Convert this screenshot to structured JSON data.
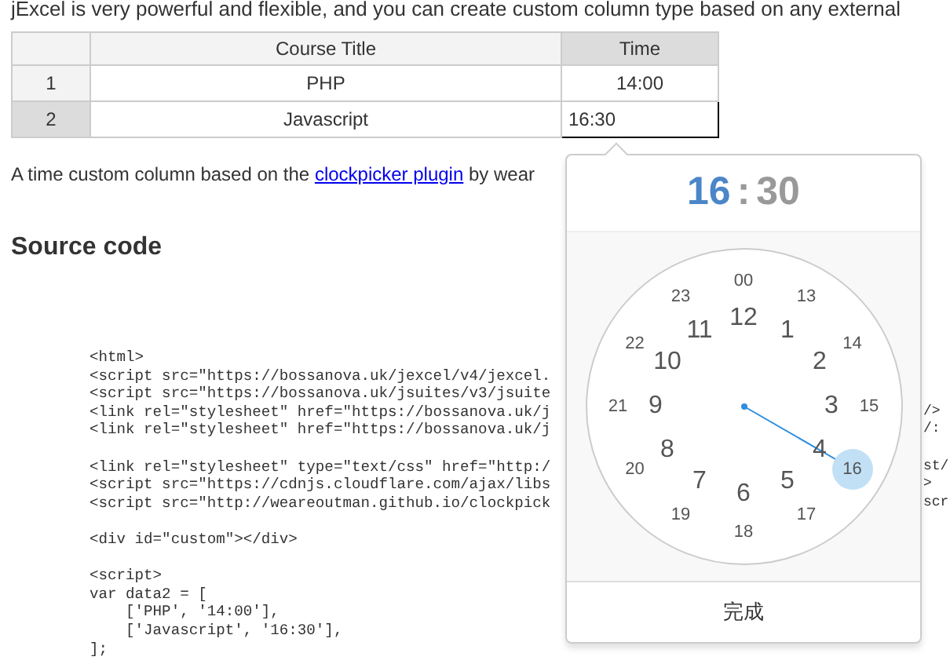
{
  "intro": "jExcel is very powerful and flexible, and you can create custom column type based on any external",
  "table": {
    "columns": [
      "Course Title",
      "Time"
    ],
    "rows": [
      {
        "number": "1",
        "cells": [
          "PHP",
          "14:00"
        ],
        "selected": false
      },
      {
        "number": "2",
        "cells": [
          "Javascript",
          "16:30"
        ],
        "selected": true
      }
    ]
  },
  "description": {
    "before": "A time custom column based on the ",
    "link": "clockpicker plugin",
    "after": " by wear"
  },
  "heading": "Source code",
  "code": [
    [
      {
        "text": "<html>"
      },
      {
        "text": "<script src=\"https://bossanova.uk/jexcel/v4/jexcel."
      },
      {
        "text": "<script src=\"https://bossanova.uk/jsuites/v3/jsuite"
      },
      {
        "text": "<link rel=\"stylesheet\" href=\"https://bossanova.uk/j",
        "tail": "/>"
      },
      {
        "text": "<link rel=\"stylesheet\" href=\"https://bossanova.uk/j",
        "tail": "/:"
      }
    ],
    [
      {
        "text": "<link rel=\"stylesheet\" type=\"text/css\" href=\"http:/",
        "tail": "st/"
      },
      {
        "text": "<script src=\"https://cdnjs.cloudflare.com/ajax/libs",
        "tail": ">"
      },
      {
        "text": "<script src=\"http://weareoutman.github.io/clockpick",
        "tail": "scr"
      }
    ],
    [
      {
        "text": "<div id=\"custom\"></div>"
      }
    ],
    [
      {
        "text": "<script>"
      },
      {
        "text": "var data2 = ["
      },
      {
        "text": "    ['PHP', '14:00'],"
      },
      {
        "text": "    ['Javascript', '16:30'],"
      },
      {
        "text": "];"
      }
    ]
  ],
  "clockpicker": {
    "hours": {
      "text": "16",
      "selected": true
    },
    "separator": ":",
    "minutes": {
      "text": "30",
      "selected": false
    },
    "inner": [
      {
        "label": "12",
        "selected": false
      },
      {
        "label": "11",
        "selected": false
      },
      {
        "label": "1",
        "selected": false
      },
      {
        "label": "10",
        "selected": false
      },
      {
        "label": "2",
        "selected": false
      },
      {
        "label": "9",
        "selected": false
      },
      {
        "label": "3",
        "selected": false
      },
      {
        "label": "8",
        "selected": false
      },
      {
        "label": "4",
        "selected": false
      },
      {
        "label": "7",
        "selected": false
      },
      {
        "label": "5",
        "selected": false
      },
      {
        "label": "6",
        "selected": false
      }
    ],
    "outer": [
      {
        "label": "00",
        "selected": false
      },
      {
        "label": "23",
        "selected": false
      },
      {
        "label": "13",
        "selected": false
      },
      {
        "label": "22",
        "selected": false
      },
      {
        "label": "14",
        "selected": false
      },
      {
        "label": "21",
        "selected": false
      },
      {
        "label": "15",
        "selected": false
      },
      {
        "label": "20",
        "selected": false
      },
      {
        "label": "16",
        "selected": true
      },
      {
        "label": "19",
        "selected": false
      },
      {
        "label": "17",
        "selected": false
      },
      {
        "label": "18",
        "selected": false
      }
    ],
    "done": "完成"
  }
}
